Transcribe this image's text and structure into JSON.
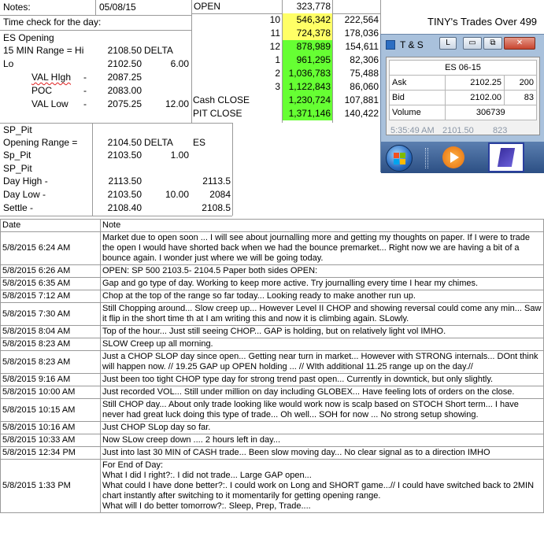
{
  "sheet": {
    "notes_label": "Notes:",
    "date_value": "05/08/15",
    "time_check": "Time check for the day:",
    "es_opening": "ES Opening",
    "range_label": "15 MIN Range = Hi",
    "range_hi": "2108.50",
    "delta_label": "DELTA",
    "lo_label": "Lo",
    "lo_value": "2102.50",
    "delta_value": "6.00",
    "val_high_label": "VAL HIgh",
    "val_high_value": "2087.25",
    "poc_label": "POC",
    "poc_value": "2083.00",
    "val_low_label": "VAL Low",
    "val_low_value": "2075.25",
    "val_low_delta": "12.00",
    "dash": "-",
    "sp_pit": "SP_Pit",
    "opening_range_label": "Opening Range =",
    "opening_range_value": "2104.50",
    "delta2_label": "DELTA",
    "es_label": "ES",
    "sp_pit2": "Sp_Pit",
    "sp_pit2_value": "2103.50",
    "sp_pit2_delta": "1.00",
    "sp_pit3": "SP_Pit",
    "day_high_label": "Day High -",
    "day_high_value": "2113.50",
    "day_high_es": "2113.5",
    "day_low_label": "Day Low -",
    "day_low_value": "2103.50",
    "day_low_delta": "10.00",
    "day_low_es": "2084",
    "settle_label": "Settle -",
    "settle_value": "2108.40",
    "settle_es": "2108.5"
  },
  "open_table": {
    "open_label": "OPEN",
    "open_value": "323,778",
    "rows": [
      {
        "hour": "10",
        "vol": "546,342",
        "delta": "222,564",
        "color": "#ffff66"
      },
      {
        "hour": "11",
        "vol": "724,378",
        "delta": "178,036",
        "color": "#ffff66"
      },
      {
        "hour": "12",
        "vol": "878,989",
        "delta": "154,611",
        "color": "#66ff33"
      },
      {
        "hour": "1",
        "vol": "961,295",
        "delta": "82,306",
        "color": "#66ff33"
      },
      {
        "hour": "2",
        "vol": "1,036,783",
        "delta": "75,488",
        "color": "#66ff33"
      },
      {
        "hour": "3",
        "vol": "1,122,843",
        "delta": "86,060",
        "color": "#66ff33"
      }
    ],
    "cash_close_label": "Cash CLOSE",
    "cash_close_vol": "1,230,724",
    "cash_close_delta": "107,881",
    "pit_close_label": "PIT CLOSE",
    "pit_close_vol": "1,371,146",
    "pit_close_delta": "140,422",
    "tiny_trades": "TINY's Trades Over 499",
    "tiny_underline": "TINY"
  },
  "ts_window": {
    "title": "T & S",
    "btn_l": "L",
    "btn_min": "▭",
    "btn_max": "⧉",
    "btn_close": "✕",
    "symbol": "ES 06-15",
    "ask_label": "Ask",
    "ask_price": "2102.25",
    "ask_size": "200",
    "bid_label": "Bid",
    "bid_price": "2102.00",
    "bid_size": "83",
    "volume_label": "Volume",
    "volume_value": "306739",
    "last_time": "5:35:49 AM",
    "last_price": "2101.50",
    "last_size": "823"
  },
  "notes_table": {
    "header_date": "Date",
    "header_note": "Note",
    "rows": [
      {
        "date": "5/8/2015 6:24 AM",
        "note": "Market due  to open soon ... I will see about journalling more and getting my thoughts on paper.  If I were to trade the open I would have shorted back when we had the bounce premarket... Right now we are having a bit of a bounce again.  I wonder just where we will be going today."
      },
      {
        "date": "5/8/2015 6:26 AM",
        "note": "OPEN: SP 500 2103.5- 2104.5 Paper both sides OPEN:"
      },
      {
        "date": "5/8/2015 6:35 AM",
        "note": "Gap and go type of day.  Working to keep more active.  Try journalling every time I hear my chimes."
      },
      {
        "date": "5/8/2015 7:12 AM",
        "note": "Chop at the top of the range so far today... Looking ready to make another run up."
      },
      {
        "date": "5/8/2015 7:30 AM",
        "note": "Still Chopping around... Slow creep up... However Level II CHOP and showing reversal could come any min... Saw it flip in the short time th at I am writing this and now it is climbing again.  SLowly."
      },
      {
        "date": "5/8/2015 8:04 AM",
        "note": "Top of the hour... Just still seeing CHOP... GAP is holding, but on relatively light vol IMHO."
      },
      {
        "date": "5/8/2015 8:23 AM",
        "note": "SLOW Creep up all morning."
      },
      {
        "date": "5/8/2015 8:23 AM",
        "note": "Just a CHOP SLOP day since open... Getting near turn in market... However with STRONG internals... DOnt think will happen now.  //  19.25 GAP up OPEN holding ...  // WIth additional 11.25 range up on the day.//"
      },
      {
        "date": "5/8/2015 9:16 AM",
        "note": "Just been too tight CHOP type day for strong trend past open... Currently in downtick, but only slightly."
      },
      {
        "date": "5/8/2015 10:00 AM",
        "note": "Just recorded VOL... Still under million on day including GLOBEX... Have feeling lots of orders on the close."
      },
      {
        "date": "5/8/2015 10:15 AM",
        "note": "Still CHOP day... About only trade looking like would work now is scalp based on STOCH Short term... I have never had great luck doing this type of trade... Oh well... SOH for now ... No strong setup showing."
      },
      {
        "date": "5/8/2015 10:16 AM",
        "note": "Just CHOP SLop day so far."
      },
      {
        "date": "5/8/2015 10:33 AM",
        "note": "Now SLow creep down .... 2 hours left in day..."
      },
      {
        "date": "5/8/2015 12:34 PM",
        "note": "Just into last 30 MIN of CASH trade... Been slow moving day... No clear signal as to a direction IMHO"
      },
      {
        "date": "5/8/2015 1:33 PM",
        "note": "For End of Day:\nWhat I did I right?:.  I did not trade... Large GAP open...\nWhat could I have done better?:.  I could work on Long and SHORT game...// I could have switched back to 2MIN chart instantly after switching to it momentarily for getting opening range.\nWhat will I do better tomorrow?:.  Sleep, Prep, Trade...."
      }
    ]
  }
}
